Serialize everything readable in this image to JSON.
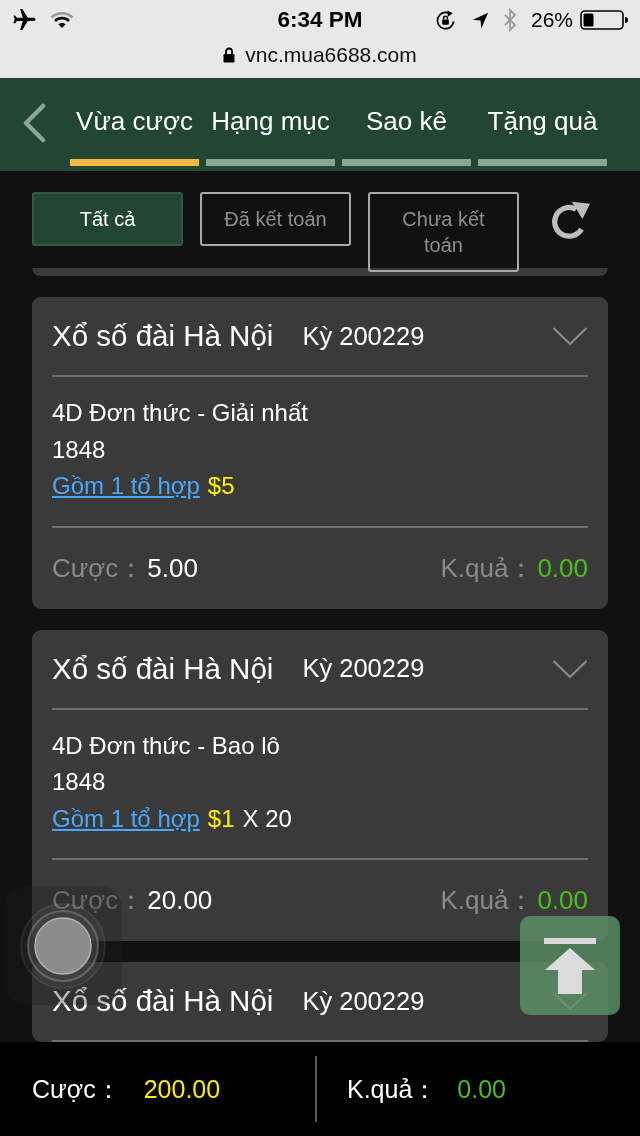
{
  "status_bar": {
    "time": "6:34 PM",
    "battery": "26%"
  },
  "browser": {
    "url": "vnc.mua6688.com"
  },
  "tabs": [
    {
      "label": "Vừa cược",
      "selected": true
    },
    {
      "label": "Hạng mục",
      "selected": false
    },
    {
      "label": "Sao kê",
      "selected": false
    },
    {
      "label": "Tặng quà",
      "selected": false
    }
  ],
  "filters": [
    {
      "label": "Tất cả",
      "selected": true
    },
    {
      "label": "Đã kết toán",
      "selected": false
    },
    {
      "label": "Chưa kết toán",
      "selected": false
    }
  ],
  "bets": [
    {
      "lottery": "Xổ số đài Hà Nội",
      "period": "Kỳ 200229",
      "bet_type": "4D Đơn thức - Giải nhất",
      "numbers": "1848",
      "combo_link": "Gồm 1 tổ hợp",
      "price": "$5",
      "stake_label": "Cược：",
      "stake": "5.00",
      "result_label": "K.quả：",
      "result": "0.00"
    },
    {
      "lottery": "Xổ số đài Hà Nội",
      "period": "Kỳ 200229",
      "bet_type": "4D Đơn thức - Bao lô",
      "numbers": "1848",
      "combo_link": "Gồm 1 tổ hợp",
      "price": "$1",
      "multiplier": "X 20",
      "stake_label": "Cược：",
      "stake": "20.00",
      "result_label": "K.quả：",
      "result": "0.00"
    },
    {
      "lottery": "Xổ số đài Hà Nội",
      "period": "Kỳ 200229"
    }
  ],
  "totals": {
    "stake_label": "Cược：",
    "stake": "200.00",
    "result_label": "K.quả：",
    "result": "0.00"
  }
}
